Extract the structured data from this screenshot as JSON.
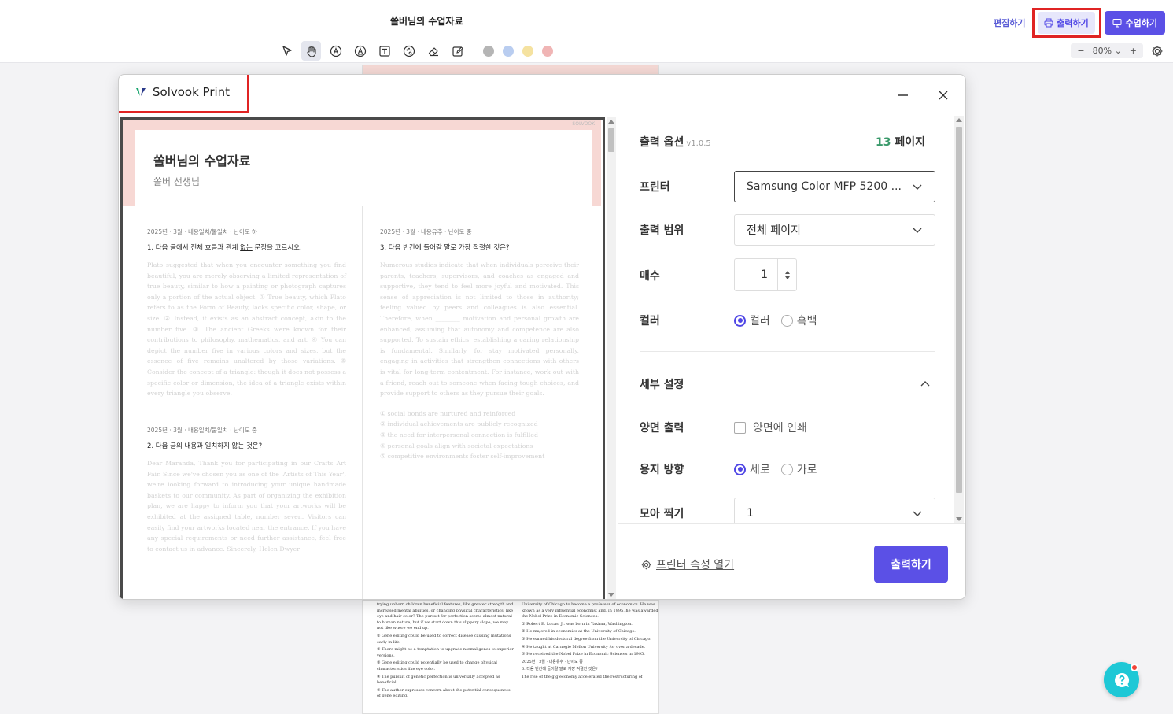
{
  "app": {
    "doc_title": "쏠버님의 수업자료",
    "edit_label": "편집하기",
    "print_label": "출력하기",
    "class_label": "수업하기",
    "zoom": "80%",
    "zoom_minus": "−",
    "zoom_plus": "+",
    "tools": [
      "pointer-icon",
      "hand-icon",
      "pen-a-icon",
      "pen-b-icon",
      "text-icon",
      "palette-icon",
      "eraser-icon",
      "edit-icon"
    ],
    "swatches": [
      "#b5b5b5",
      "#b9cdf0",
      "#f5e2a0",
      "#f0b5b5"
    ]
  },
  "modal": {
    "brand": "Solvook Print",
    "preview": {
      "title": "쏠버님의 수업자료",
      "subtitle": "쏠버 선생님",
      "tag": "SOLVOOK",
      "q1": {
        "meta": "2025년 · 3월 · 내용일치/불일치 · 난이도 하",
        "text_before": "1. 다음 글에서 전체 흐름과 관계 ",
        "text_u": "없는",
        "text_after": " 문장을 고르시오.",
        "body": "Plato suggested that when you encounter something you find beautiful, you are merely observing a limited representation of true beauty, similar to how a painting or photograph captures only a portion of the actual object. ① True beauty, which Plato refers to as the Form of Beauty, lacks specific color, shape, or size. ② Instead, it exists as an abstract concept, akin to the number five. ③ The ancient Greeks were known for their contributions to philosophy, mathematics, and art. ④ You can depict the number five in various colors and sizes, but the essence of five remains unaltered by those variations. ⑤ Consider the concept of a triangle: though it does not possess a specific color or dimension, the idea of a triangle exists within every triangle you observe."
      },
      "q2": {
        "meta": "2025년 · 3월 · 내용일치/불일치 · 난이도 중",
        "text_before": "2. 다음 글의 내용과 일치하지 ",
        "text_u": "않는",
        "text_after": " 것은?",
        "body": "Dear Maranda, Thank you for participating in our Crafts Art Fair. Since we've chosen you as one of the 'Artists of This Year', we're looking forward to introducing your unique handmade baskets to our community. As part of organizing the exhibition plan, we are happy to inform you that your artworks will be exhibited at the assigned table, number seven. Visitors can easily find your artworks located near the entrance. If you have any special requirements or need further assistance, feel free to contact us in advance. Sincerely, Helen Dwyer"
      },
      "q3": {
        "meta": "2025년 · 3월 · 내용유추 · 난이도 중",
        "text": "3. 다음 빈칸에 들어갈 말로 가장 적절한 것은?",
        "body": "Numerous studies indicate that when individuals perceive their parents, teachers, supervisors, and coaches as engaged and supportive, they tend to feel more joyful and motivated. This sense of appreciation is not limited to those in authority; feeling valued by peers and colleagues is also essential. Therefore, when ________ motivation and personal growth are enhanced, assuming that autonomy and competence are also supported. To sustain ethics, establishing a caring relationship is fundamental. Similarly, for stay motivated personally, engaging in activities that strengthen connections with others is vital for long-term contentment. For instance, work out with a friend, reach out to someone when facing tough choices, and provide support to others as they pursue their goals.",
        "options": [
          "① social bonds are nurtured and reinforced",
          "② individual achievements are publicly recognized",
          "③ the need for interpersonal connection is fulfilled",
          "④ personal goals align with societal expectations",
          "⑤ competitive environments foster self-improvement"
        ]
      }
    },
    "options": {
      "title": "출력 옵션",
      "version": "v1.0.5",
      "pages_num": "13",
      "pages_unit": "페이지",
      "printer_label": "프린터",
      "printer_value": "Samsung Color MFP 5200 ...",
      "range_label": "출력 범위",
      "range_value": "전체 페이지",
      "copies_label": "매수",
      "copies_value": "1",
      "color_label": "컬러",
      "color_opt1": "컬러",
      "color_opt2": "흑백",
      "detail_label": "세부 설정",
      "duplex_label": "양면 출력",
      "duplex_check": "양면에 인쇄",
      "orient_label": "용지 방향",
      "orient_opt1": "세로",
      "orient_opt2": "가로",
      "nup_label": "모아 찍기",
      "nup_value": "1"
    },
    "footer": {
      "printer_props": "프린터 속성 열기",
      "print_button": "출력하기"
    }
  },
  "background_page": {
    "left_lines": [
      "trying unborn children beneficial features, like greater strength and increased mental abilities, or changing physical characteristics, like eye and hair color? The pursuit for perfection seems almost natural to human nature, but if we start down this slippery slope, we may not like where we end up.",
      "① Gene editing could be used to correct disease causing mutations early in life.",
      "② There might be a temptation to upgrade normal genes to superior versions.",
      "③ Gene editing could potentially be used to change physical characteristics like eye color.",
      "④ The pursuit of genetic perfection is universally accepted as beneficial.",
      "⑤ The author expresses concern about the potential consequences of gene editing."
    ],
    "right_lines": [
      "University of Chicago to become a professor of economics. He was known as a very influential economist and, in 1995, he was awarded the Nobel Prize in Economic Sciences.",
      "① Robert E. Lucas, Jr. was born in Yakima, Washington.",
      "② He majored in economics at the University of Chicago.",
      "③ He earned his doctoral degree from the University of Chicago.",
      "④ He taught at Carnegie Mellon University for over a decade.",
      "⑤ He received the Nobel Prize in Economic Sciences in 1995.",
      "2025년 · 3월 · 내용유추 · 난이도 중",
      "6. 다음 빈칸에 들어갈 말로 가장 적절한 것은?",
      "The rise of the gig economy accelerated the restructuring of"
    ]
  }
}
